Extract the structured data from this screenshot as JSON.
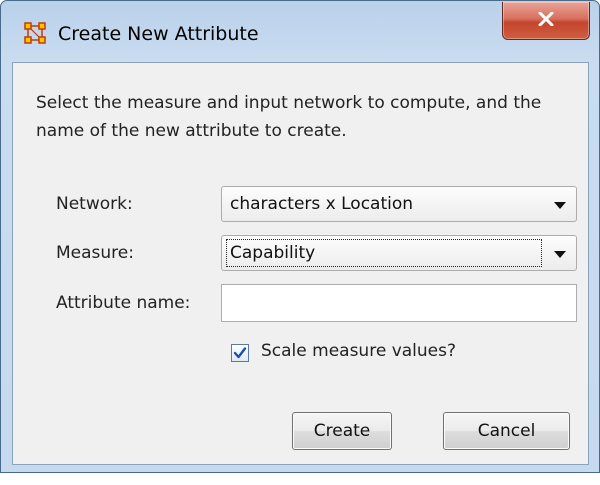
{
  "window": {
    "title": "Create New Attribute",
    "close_glyph": "X",
    "app_icon": "network-nodes-icon"
  },
  "description": "Select the measure and input network to compute, and the name of the new attribute to create.",
  "form": {
    "network": {
      "label": "Network:",
      "value": "characters x Location"
    },
    "measure": {
      "label": "Measure:",
      "value": "Capability"
    },
    "attribute_name": {
      "label": "Attribute name:",
      "value": "",
      "placeholder": ""
    },
    "scale": {
      "label": "Scale measure values?",
      "checked": true
    }
  },
  "buttons": {
    "create": "Create",
    "cancel": "Cancel"
  },
  "colors": {
    "frame": "#c6d9ee",
    "close_button": "#c3452e",
    "icon": "#e07b00"
  }
}
